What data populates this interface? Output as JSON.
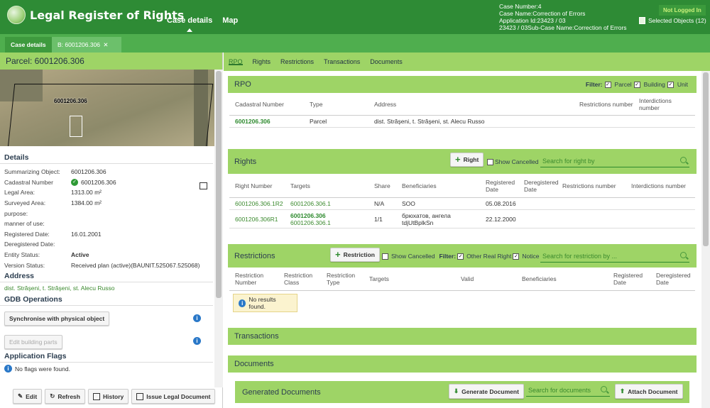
{
  "header": {
    "app_title": "Legal Register of Rights",
    "nav": [
      "Case details",
      "Map"
    ],
    "case_info": [
      "Case Number:4",
      "Case Name:Correction of Errors",
      "Application Id:23423 / 03",
      "23423 / 03Sub-Case Name:Correction of Errors"
    ],
    "login_status": "Not Logged In",
    "selected_objects": "Selected Objects (12)"
  },
  "tabs": [
    {
      "label": "Case details"
    },
    {
      "label": "B: 6001206.306",
      "close": "✕"
    }
  ],
  "left": {
    "parcel_title": "Parcel: 6001206.306",
    "map_label": "6001206.306",
    "details_title": "Details",
    "details": [
      {
        "k": "Summarizing Object:",
        "v": "6001206.306"
      },
      {
        "k": "Cadastral Number",
        "v": "6001206.306"
      },
      {
        "k": "Legal Area:",
        "v": "1313.00 m²"
      },
      {
        "k": "Surveyed Area:",
        "v": "1384.00 m²"
      },
      {
        "k": "purpose:",
        "v": ""
      },
      {
        "k": "manner of use:",
        "v": ""
      },
      {
        "k": "Registered Date:",
        "v": "16.01.2001"
      },
      {
        "k": "Deregistered Date:",
        "v": ""
      },
      {
        "k": "Entity Status:",
        "v": "Active"
      },
      {
        "k": "Version Status:",
        "v": "Received plan (active)(BAUNIT.525067.525068)"
      }
    ],
    "address_title": "Address",
    "address": "dist. Străşeni, t. Străşeni, st. Alecu Russo",
    "gdb_title": "GDB Operations",
    "sync_btn": "Synchronise with physical object",
    "edit_parts_btn": "Edit building parts",
    "flags_title": "Application Flags",
    "no_flags": "No flags were found.",
    "toolbar": [
      "Edit",
      "Refresh",
      "History",
      "Issue Legal Document"
    ]
  },
  "right": {
    "subnav": [
      "RPO",
      "Rights",
      "Restrictions",
      "Transactions",
      "Documents"
    ],
    "rpo": {
      "title": "RPO",
      "filter_label": "Filter:",
      "filters": [
        "Parcel",
        "Building",
        "Unit"
      ],
      "columns": [
        "Cadastral Number",
        "Type",
        "Address",
        "Restrictions number",
        "Interdictions number"
      ],
      "rows": [
        [
          "6001206.306",
          "Parcel",
          "dist. Străşeni, t. Străşeni, st. Alecu Russo",
          "",
          ""
        ]
      ]
    },
    "rights": {
      "title": "Rights",
      "add_btn": "Right",
      "show_cancelled": "Show Cancelled",
      "search_placeholder": "Search for right by",
      "columns": [
        "Right Number",
        "Targets",
        "Share",
        "Beneficiaries",
        "Registered Date",
        "Deregistered Date",
        "Restrictions number",
        "Interdictions number"
      ],
      "rows": [
        {
          "number": "6001206.306.1R2",
          "targets": [
            "6001206.306.1"
          ],
          "share": "N/A",
          "beneficiaries": [
            "SOO"
          ],
          "registered": "05.08.2016"
        },
        {
          "number": "6001206.306R1",
          "targets": [
            "6001206.306",
            "6001206.306.1"
          ],
          "share": "1/1",
          "beneficiaries": [
            "брюхатов, ангела",
            "tdjUtBplkSn"
          ],
          "registered": "22.12.2000"
        }
      ]
    },
    "restrictions": {
      "title": "Restrictions",
      "add_btn": "Restriction",
      "show_cancelled": "Show Cancelled",
      "filter_label": "Filter:",
      "filters": [
        "Other Real Right",
        "Notice"
      ],
      "search_placeholder": "Search for restriction by ...",
      "columns": [
        "Restriction Number",
        "Restriction Class",
        "Restriction Type",
        "Targets",
        "Valid",
        "Beneficiaries",
        "Registered Date",
        "Deregistered Date"
      ],
      "no_results": "No results found."
    },
    "transactions_title": "Transactions",
    "documents_title": "Documents",
    "generated": {
      "title": "Generated Documents",
      "generate_btn": "Generate Document",
      "search_placeholder": "Search for documents",
      "attach_btn": "Attach Document"
    }
  },
  "colors": {
    "header": "#2e8b35",
    "tabbar": "#4fae4e",
    "panel": "#9ed466",
    "link": "#3b8a2e"
  }
}
